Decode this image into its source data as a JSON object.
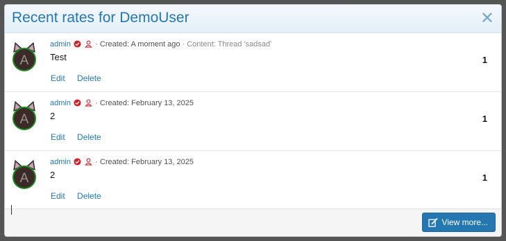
{
  "modal": {
    "title": "Recent rates for DemoUser",
    "close_icon": "close-icon"
  },
  "rates": [
    {
      "avatar_letter": "A",
      "username": "admin",
      "created": "· Created: A moment ago",
      "content": "· Content: Thread 'sadsad'",
      "text": "Test",
      "edit_label": "Edit",
      "delete_label": "Delete",
      "count": "1"
    },
    {
      "avatar_letter": "A",
      "username": "admin",
      "created": "· Created: February 13, 2025",
      "content": "",
      "text": "2",
      "edit_label": "Edit",
      "delete_label": "Delete",
      "count": "1"
    },
    {
      "avatar_letter": "A",
      "username": "admin",
      "created": "· Created: February 13, 2025",
      "content": "",
      "text": "2",
      "edit_label": "Edit",
      "delete_label": "Delete",
      "count": "1"
    }
  ],
  "footer": {
    "view_more_label": "View more..."
  },
  "colors": {
    "accent": "#2577b1",
    "badge_red": "#d0202a",
    "avatar_bg": "#3b2a28",
    "avatar_ring": "#1e8a1e"
  }
}
